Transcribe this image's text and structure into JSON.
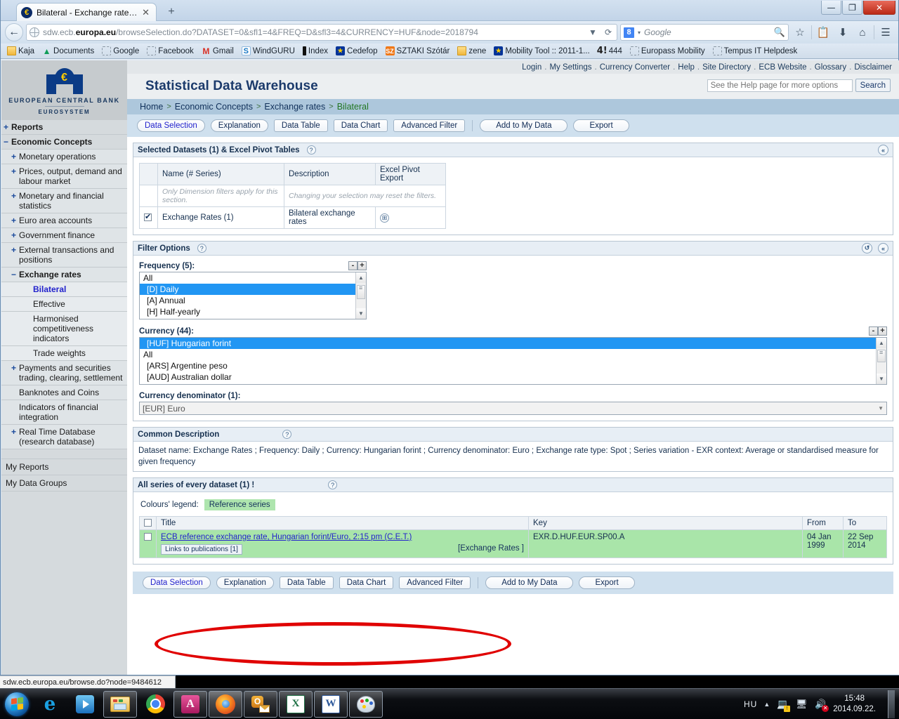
{
  "browser": {
    "tab": {
      "title": "Bilateral - Exchange rates - ...",
      "favicon": "€",
      "close": "✕"
    },
    "new_tab": "+",
    "window_buttons": {
      "minimize": "—",
      "maximize": "❐",
      "close": "✕"
    },
    "nav": {
      "back": "←",
      "forward": "→",
      "reload": "⟳",
      "dropdown": "▼"
    },
    "url": {
      "prefix": "sdw.ecb.",
      "domain": "europa.eu",
      "path": "/browseSelection.do?DATASET=0&sfl1=4&FREQ=D&sfl3=4&CURRENCY=HUF&node=2018794"
    },
    "search": {
      "engine": "Google",
      "placeholder": "Google",
      "icon": "8"
    },
    "toolbar_icons": [
      "star-icon",
      "reading-list-icon",
      "downloads-icon",
      "home-icon",
      "menu-icon"
    ],
    "bookmarks": [
      {
        "label": "Kaja",
        "icon": "folder"
      },
      {
        "label": "Documents",
        "icon": "drive"
      },
      {
        "label": "Google",
        "icon": "dash"
      },
      {
        "label": "Facebook",
        "icon": "dash"
      },
      {
        "label": "Gmail",
        "icon": "gmail"
      },
      {
        "label": "WindGURU",
        "icon": "wind"
      },
      {
        "label": "Index",
        "icon": "index"
      },
      {
        "label": "Cedefop",
        "icon": "eu"
      },
      {
        "label": "SZTAKI Szótár",
        "icon": "sz"
      },
      {
        "label": "zene",
        "icon": "folder"
      },
      {
        "label": "Mobility Tool :: 2011-1...",
        "icon": "eu"
      },
      {
        "label": "444",
        "icon": "444"
      },
      {
        "label": "Europass Mobility",
        "icon": "dash"
      },
      {
        "label": "Tempus IT Helpdesk",
        "icon": "dash"
      }
    ]
  },
  "logo": {
    "symbol": "€",
    "line1": "EUROPEAN CENTRAL BANK",
    "line2": "EUROSYSTEM"
  },
  "sidebar": {
    "items": [
      {
        "label": "Reports",
        "level": 1,
        "marker": "+",
        "bold": true
      },
      {
        "label": "Economic Concepts",
        "level": 1,
        "marker": "−",
        "bold": true
      },
      {
        "label": "Monetary operations",
        "level": 2,
        "marker": "+"
      },
      {
        "label": "Prices, output, demand and labour market",
        "level": 2,
        "marker": "+"
      },
      {
        "label": "Monetary and financial statistics",
        "level": 2,
        "marker": "+"
      },
      {
        "label": "Euro area accounts",
        "level": 2,
        "marker": "+"
      },
      {
        "label": "Government finance",
        "level": 2,
        "marker": "+"
      },
      {
        "label": "External transactions and positions",
        "level": 2,
        "marker": "+"
      },
      {
        "label": "Exchange rates",
        "level": 2,
        "marker": "−",
        "bold": true
      },
      {
        "label": "Bilateral",
        "level": 3,
        "marker": "",
        "link": true
      },
      {
        "label": "Effective",
        "level": 3,
        "marker": ""
      },
      {
        "label": "Harmonised competitiveness indicators",
        "level": 3,
        "marker": ""
      },
      {
        "label": "Trade weights",
        "level": 3,
        "marker": ""
      },
      {
        "label": "Payments and securities trading, clearing, settlement",
        "level": 2,
        "marker": "+"
      },
      {
        "label": "Banknotes and Coins",
        "level": 2,
        "marker": ""
      },
      {
        "label": "Indicators of financial integration",
        "level": 2,
        "marker": ""
      },
      {
        "label": "Real Time Database (research database)",
        "level": 2,
        "marker": "+"
      }
    ],
    "my_reports": "My Reports",
    "my_data_groups": "My Data Groups"
  },
  "top_links": [
    "Login",
    "My Settings",
    "Currency Converter",
    "Help",
    "Site Directory",
    "ECB Website",
    "Glossary",
    "Disclaimer"
  ],
  "header": {
    "title": "Statistical Data Warehouse",
    "search_placeholder": "See the Help page for more options",
    "search_button": "Search"
  },
  "breadcrumb": {
    "items": [
      "Home",
      "Economic Concepts",
      "Exchange rates"
    ],
    "current": "Bilateral",
    "separator": ">"
  },
  "toolbar": {
    "buttons": [
      "Data Selection",
      "Explanation",
      "Data Table",
      "Data Chart",
      "Advanced Filter"
    ],
    "right_buttons": [
      "Add to My Data",
      "Export"
    ]
  },
  "datasets_panel": {
    "title": "Selected Datasets (1) & Excel Pivot Tables",
    "help": "?",
    "collapse": "«",
    "headers": [
      "",
      "Name (# Series)",
      "Description",
      "Excel Pivot Export"
    ],
    "notes": [
      "Only Dimension filters apply for this section.",
      "Changing your selection may reset the filters."
    ],
    "row": {
      "checked": true,
      "name": "Exchange Rates   (1)",
      "description": "Bilateral exchange rates",
      "pivot_icon": "⊞"
    }
  },
  "filter_panel": {
    "title": "Filter Options",
    "help": "?",
    "reset": "↺",
    "collapse": "«",
    "frequency": {
      "label": "Frequency (5):",
      "minus": "-",
      "plus": "+",
      "options": [
        "All",
        "[D] Daily",
        "[A] Annual",
        "[H] Half-yearly"
      ],
      "selected": "[D] Daily"
    },
    "currency": {
      "label": "Currency  (44):",
      "minus": "-",
      "plus": "+",
      "options": [
        "[HUF] Hungarian forint",
        "All",
        "[ARS] Argentine peso",
        "[AUD] Australian dollar"
      ],
      "selected": "[HUF] Hungarian forint"
    },
    "denominator": {
      "label": "Currency denominator  (1):",
      "value": "[EUR] Euro",
      "caret": "▼"
    }
  },
  "common_description": {
    "title": "Common Description",
    "help": "?",
    "text": "Dataset name: Exchange Rates ; Frequency: Daily ; Currency: Hungarian forint ; Currency denominator: Euro ; Exchange rate type: Spot ; Series variation - EXR context: Average or standardised measure for given frequency"
  },
  "series_panel": {
    "title": "All series of every dataset (1) !",
    "help": "?",
    "legend_label": "Colours' legend:",
    "legend_chip": "Reference series",
    "headers": [
      "",
      "Title",
      "Key",
      "From",
      "To"
    ],
    "rows": [
      {
        "title": "ECB reference exchange rate, Hungarian forint/Euro, 2:15 pm (C.E.T.)",
        "pub_link": "Links to publications [1]",
        "dataset_tag": "[Exchange Rates ]",
        "key": "EXR.D.HUF.EUR.SP00.A",
        "from": "04 Jan 1999",
        "to": "22 Sep 2014"
      }
    ]
  },
  "status_bar": {
    "text": "sdw.ecb.europa.eu/browse.do?node=9484612"
  },
  "annotation": {
    "shape": "red-oval-highlight",
    "color": "#e00000"
  },
  "taskbar": {
    "start": "start-orb",
    "items": [
      {
        "name": "internet-explorer",
        "glyph": "e"
      },
      {
        "name": "windows-media-player",
        "glyph": ""
      },
      {
        "name": "windows-explorer",
        "glyph": ""
      },
      {
        "name": "google-chrome",
        "glyph": ""
      },
      {
        "name": "microsoft-access",
        "glyph": "A"
      },
      {
        "name": "mozilla-firefox",
        "glyph": ""
      },
      {
        "name": "microsoft-outlook",
        "glyph": "O"
      },
      {
        "name": "microsoft-excel",
        "glyph": "X"
      },
      {
        "name": "microsoft-word",
        "glyph": "W"
      },
      {
        "name": "paint",
        "glyph": ""
      }
    ],
    "tray": {
      "language": "HU",
      "caret": "▲",
      "time": "15:48",
      "date": "2014.09.22."
    }
  }
}
